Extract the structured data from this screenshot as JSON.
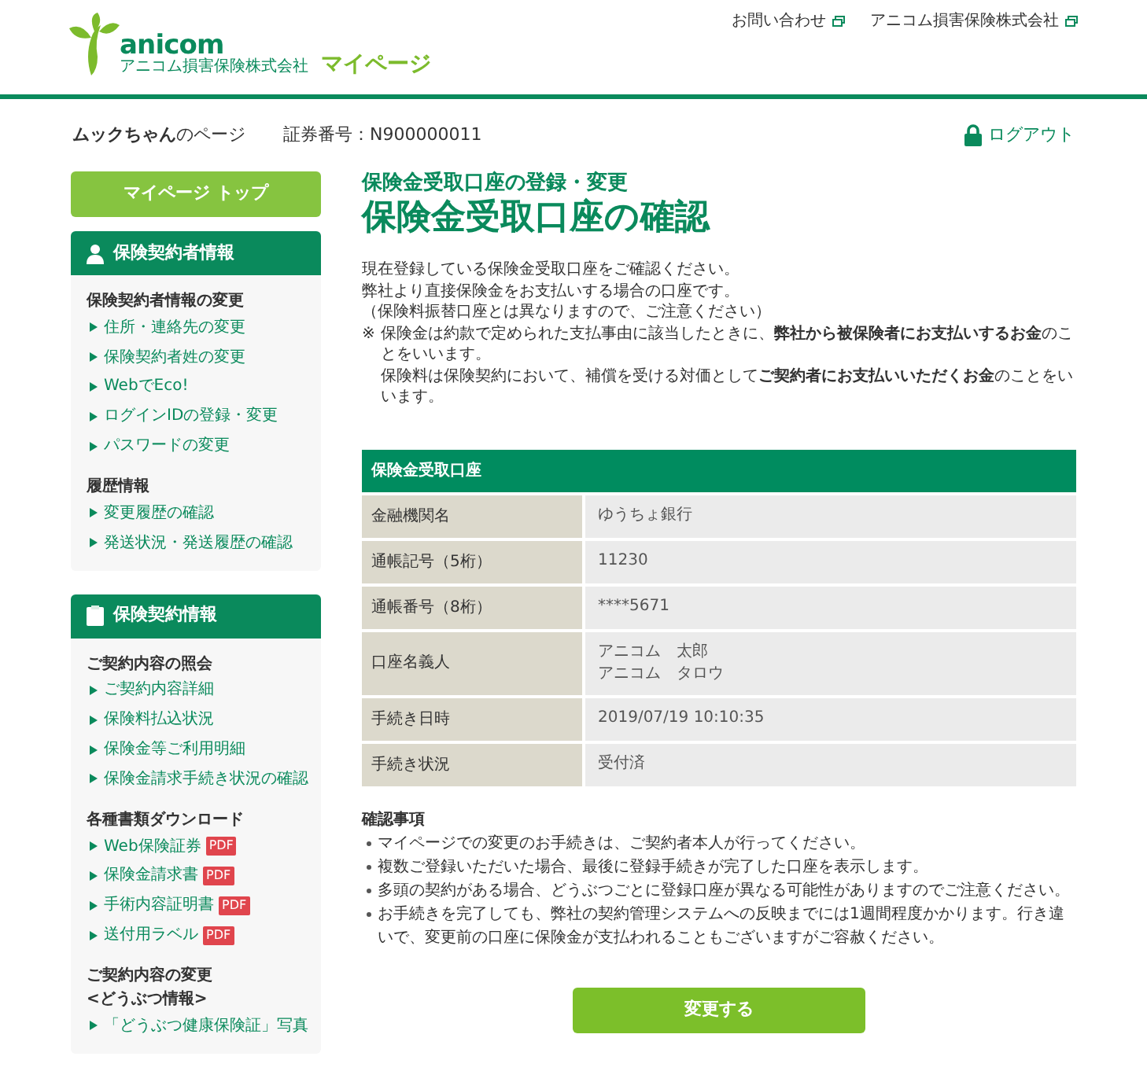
{
  "header": {
    "brand": "anicom",
    "company": "アニコム損害保険株式会社",
    "mypage": "マイページ",
    "links": [
      "お問い合わせ",
      "アニコム損害保険株式会社"
    ]
  },
  "subheader": {
    "page_owner": "**ムックちゃん**のページ",
    "policy_number": "証券番号：N900000011",
    "logout": "ログアウト"
  },
  "sidebar": {
    "top_button": "マイページ トップ",
    "sections": [
      {
        "title": "保険契約者情報",
        "kind": "person",
        "groups": [
          {
            "heading": [
              "保険契約者情報の変更"
            ],
            "items": [
              {
                "label": "住所・連絡先の変更"
              },
              {
                "label": "保険契約者姓の変更"
              },
              {
                "label": "WebでEco!"
              },
              {
                "label": "ログインIDの登録・変更"
              },
              {
                "label": "パスワードの変更"
              }
            ]
          },
          {
            "heading": [
              "履歴情報"
            ],
            "items": [
              {
                "label": "変更履歴の確認"
              },
              {
                "label": "発送状況・発送履歴の確認"
              }
            ]
          }
        ]
      },
      {
        "title": "保険契約情報",
        "kind": "document",
        "groups": [
          {
            "heading": [
              "ご契約内容の照会"
            ],
            "items": [
              {
                "label": "ご契約内容詳細"
              },
              {
                "label": "保険料払込状況"
              },
              {
                "label": "保険金等ご利用明細"
              },
              {
                "label": "保険金請求手続き状況の確認"
              }
            ]
          },
          {
            "heading": [
              "各種書類ダウンロード"
            ],
            "items": [
              {
                "label": "Web保険証券",
                "badge": "PDF"
              },
              {
                "label": "保険金請求書",
                "badge": "PDF"
              },
              {
                "label": "手術内容証明書",
                "badge": "PDF"
              },
              {
                "label": "送付用ラベル",
                "badge": "PDF"
              }
            ]
          },
          {
            "heading": [
              "ご契約内容の変更",
              "<どうぶつ情報>"
            ],
            "items": [
              {
                "label": "「どうぶつ健康保険証」写真"
              }
            ]
          }
        ]
      }
    ]
  },
  "main": {
    "subtitle": "保険金受取口座の登録・変更",
    "title": "保険金受取口座の確認",
    "intro": [
      "現在登録している保険金受取口座をご確認ください。",
      "弊社より直接保険金をお支払いする場合の口座です。",
      "（保険料振替口座とは異なりますので、ご注意ください）"
    ],
    "note_mark": "※",
    "notes": [
      "保険金は約款で定められた支払事由に該当したときに、**弊社から被保険者にお支払いするお金**のことをいいます。",
      "保険料は保険契約において、補償を受ける対価として**ご契約者にお支払いいただくお金**のことをいいます。"
    ],
    "table": {
      "title": "保険金受取口座",
      "rows": [
        {
          "label": "金融機関名",
          "values": [
            "ゆうちょ銀行"
          ]
        },
        {
          "label": "通帳記号（5桁）",
          "values": [
            "11230"
          ]
        },
        {
          "label": "通帳番号（8桁）",
          "values": [
            "****5671"
          ]
        },
        {
          "label": "口座名義人",
          "values": [
            "アニコム　太郎",
            "アニコム　タロウ"
          ]
        },
        {
          "label": "手続き日時",
          "values": [
            "2019/07/19 10:10:35"
          ]
        },
        {
          "label": "手続き状況",
          "values": [
            "受付済"
          ]
        }
      ]
    },
    "confirm_title": "確認事項",
    "confirm_items": [
      "マイページでの変更のお手続きは、ご契約者本人が行ってください。",
      "複数ご登録いただいた場合、最後に登録手続きが完了した口座を表示します。",
      "多頭の契約がある場合、どうぶつごとに登録口座が異なる可能性がありますのでご注意ください。",
      "お手続きを完了しても、弊社の契約管理システムへの反映までには1週間程度かかります。行き違いで、変更前の口座に保険金が支払われることもございますがご容赦ください。"
    ],
    "button": "変更する"
  }
}
